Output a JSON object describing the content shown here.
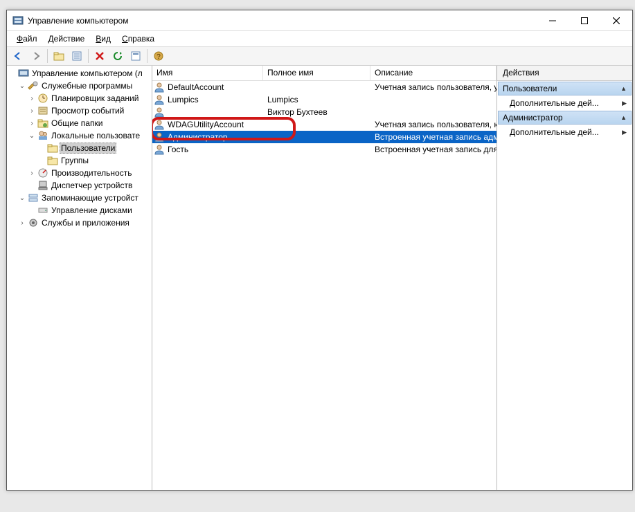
{
  "titlebar": {
    "title": "Управление компьютером"
  },
  "menu": {
    "file": "Файл",
    "action": "Действие",
    "view": "Вид",
    "help": "Справка"
  },
  "tree": {
    "root": "Управление компьютером (л",
    "tools": "Служебные программы",
    "scheduler": "Планировщик заданий",
    "eventviewer": "Просмотр событий",
    "sharedfolders": "Общие папки",
    "localusers": "Локальные пользовате",
    "users": "Пользователи",
    "groups": "Группы",
    "performance": "Производительность",
    "devicemgr": "Диспетчер устройств",
    "storage": "Запоминающие устройст",
    "diskmgmt": "Управление дисками",
    "services": "Службы и приложения"
  },
  "list": {
    "headers": {
      "name": "Имя",
      "fullname": "Полное имя",
      "description": "Описание"
    },
    "rows": [
      {
        "name": "DefaultAccount",
        "fullname": "",
        "description": "Учетная запись пользователя, у"
      },
      {
        "name": "Lumpics",
        "fullname": "Lumpics",
        "description": ""
      },
      {
        "name": "",
        "fullname": "Виктор Бухтеев",
        "description": ""
      },
      {
        "name": "WDAGUtilityAccount",
        "fullname": "",
        "description": "Учетная запись пользователя, к"
      },
      {
        "name": "Администратор",
        "fullname": "",
        "description": "Встроенная учетная запись адм",
        "selected": true
      },
      {
        "name": "Гость",
        "fullname": "",
        "description": "Встроенная учетная запись для"
      }
    ]
  },
  "actions": {
    "header": "Действия",
    "group1": "Пользователи",
    "more": "Дополнительные дей...",
    "group2": "Администратор"
  }
}
